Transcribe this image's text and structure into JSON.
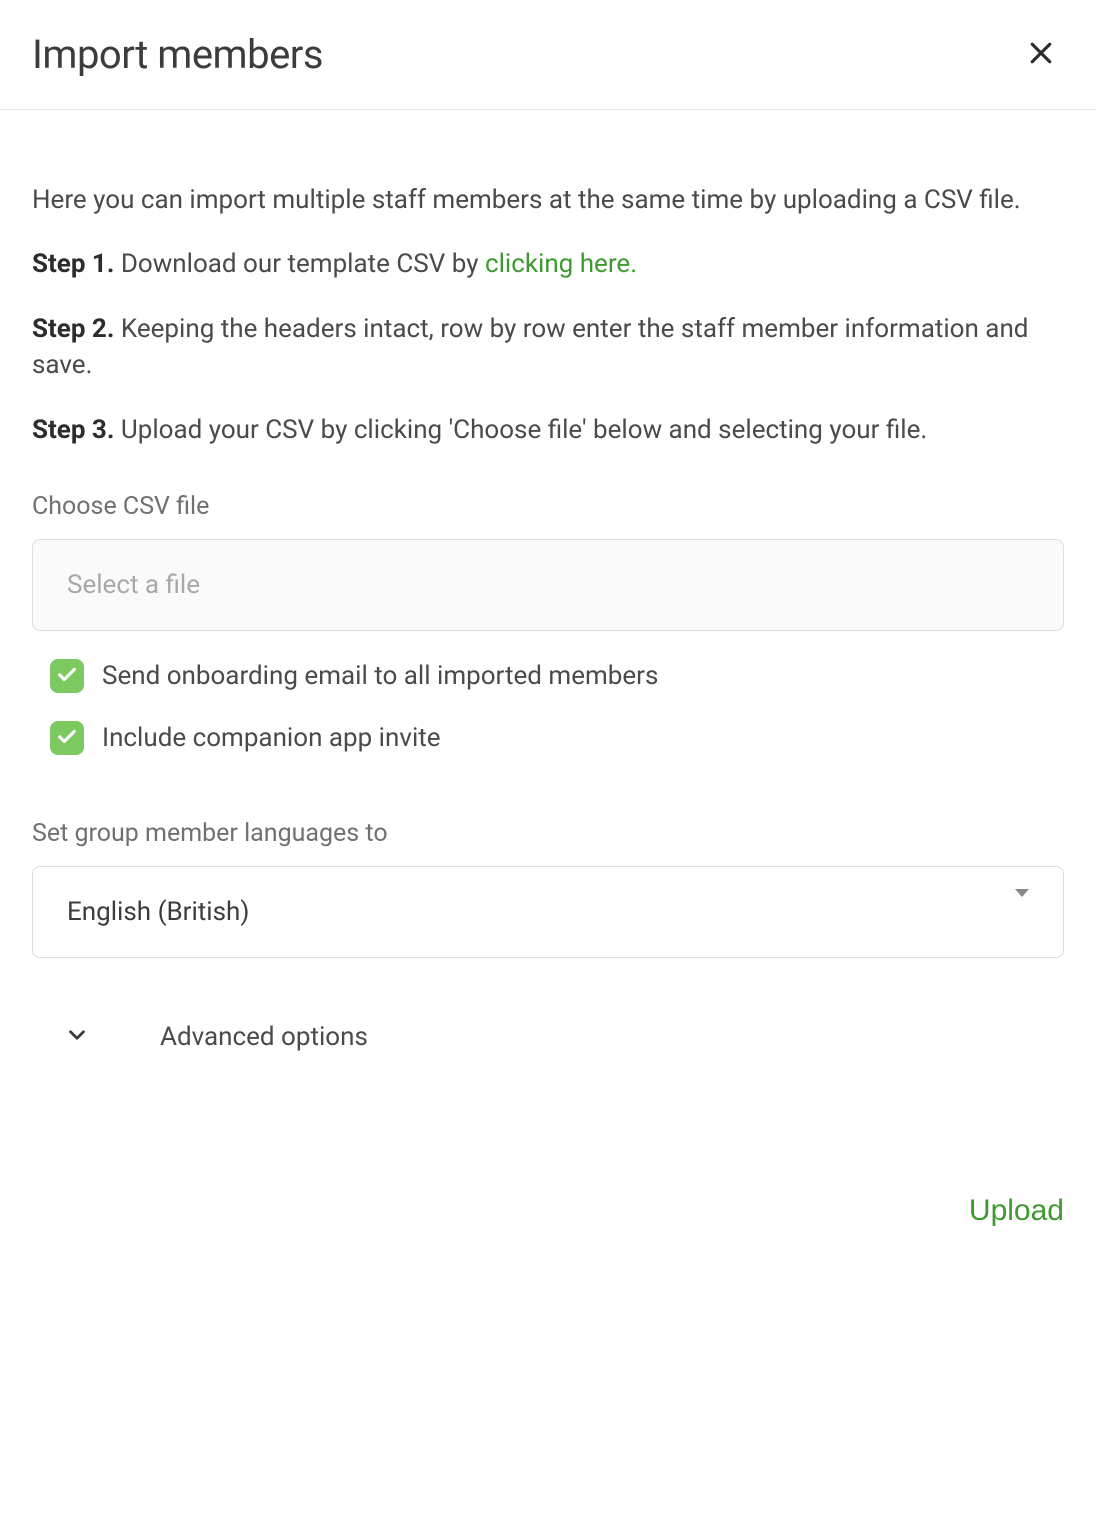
{
  "header": {
    "title": "Import members"
  },
  "intro": "Here you can import multiple staff members at the same time by uploading a CSV file.",
  "steps": {
    "step1_label": "Step 1.",
    "step1_text_before": " Download our template CSV by ",
    "step1_link": "clicking here.",
    "step2_label": "Step 2.",
    "step2_text": " Keeping the headers intact, row by row enter the staff member information and save.",
    "step3_label": "Step 3.",
    "step3_text": " Upload your CSV by clicking 'Choose file' below and selecting your file."
  },
  "file_field": {
    "label": "Choose CSV file",
    "placeholder": "Select a file"
  },
  "checkboxes": {
    "onboarding_email": {
      "label": "Send onboarding email to all imported members",
      "checked": true
    },
    "companion_invite": {
      "label": "Include companion app invite",
      "checked": true
    }
  },
  "language": {
    "label": "Set group member languages to",
    "selected": "English (British)"
  },
  "advanced": {
    "label": "Advanced options"
  },
  "actions": {
    "upload": "Upload"
  }
}
